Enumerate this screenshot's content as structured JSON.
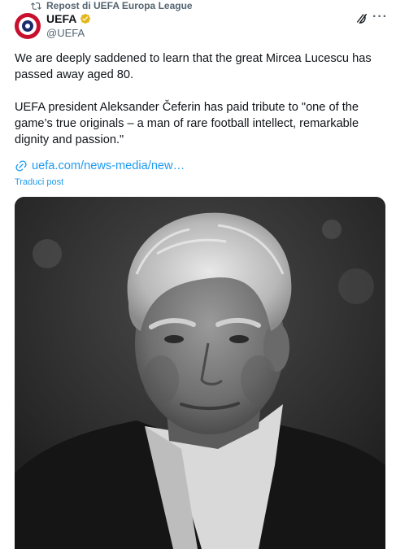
{
  "repost": {
    "label": "Repost di UEFA Europa League"
  },
  "author": {
    "name": "UEFA",
    "handle": "@UEFA",
    "verified_color": "#e2b719"
  },
  "tweet": {
    "paragraph1": "We are deeply saddened to learn that the great Mircea Lucescu has passed away aged 80.",
    "paragraph2": "UEFA president Aleksander Čeferin has paid tribute to \"one of the game’s true originals – a man of rare football intellect, remarkable dignity and passion.\"",
    "link": "uefa.com/news-media/new…",
    "translate": "Traduci post"
  },
  "actions": {
    "more": "···"
  },
  "colors": {
    "link": "#1d9bf0",
    "secondary_text": "#536471",
    "brand_red": "#c8102e"
  },
  "media": {
    "alt": "black-and-white portrait photo"
  }
}
